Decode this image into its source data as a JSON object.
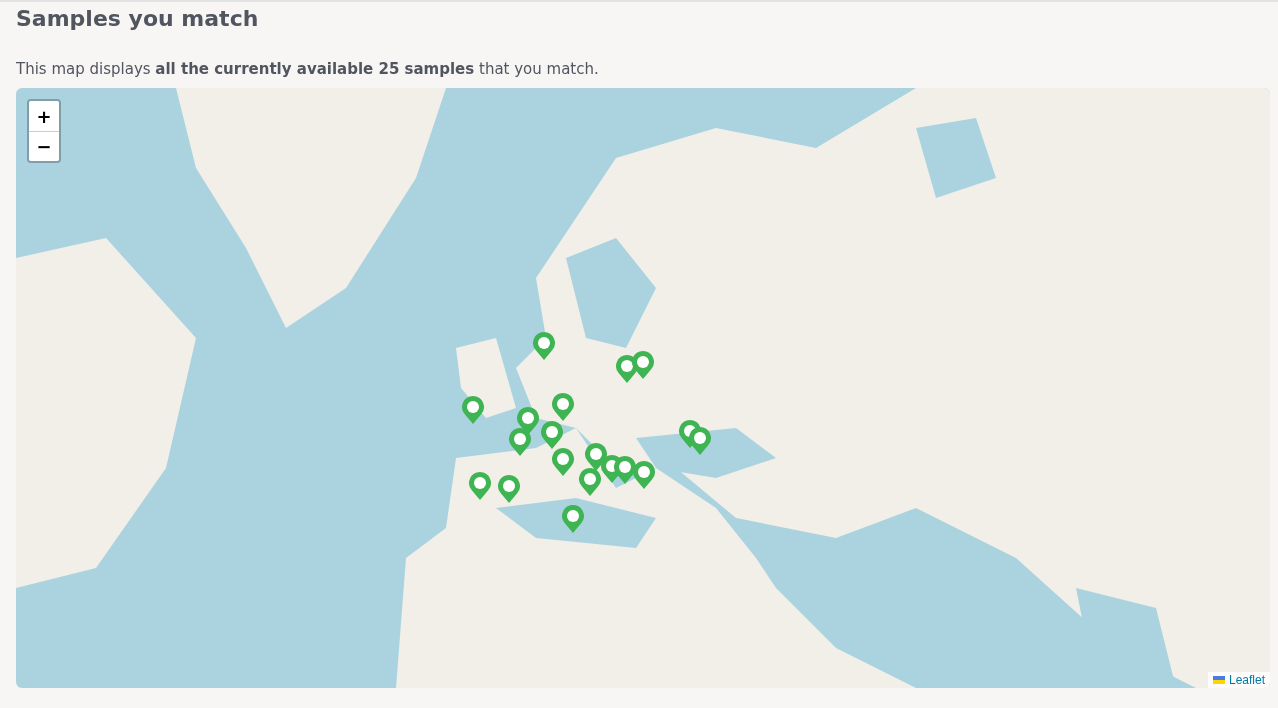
{
  "heading": "Samples you match",
  "intro": "This map displays **all the currently available 25 samples** that you match.",
  "map": {
    "zoom_in": "+",
    "zoom_out": "−",
    "attribution": "Leaflet"
  }
}
